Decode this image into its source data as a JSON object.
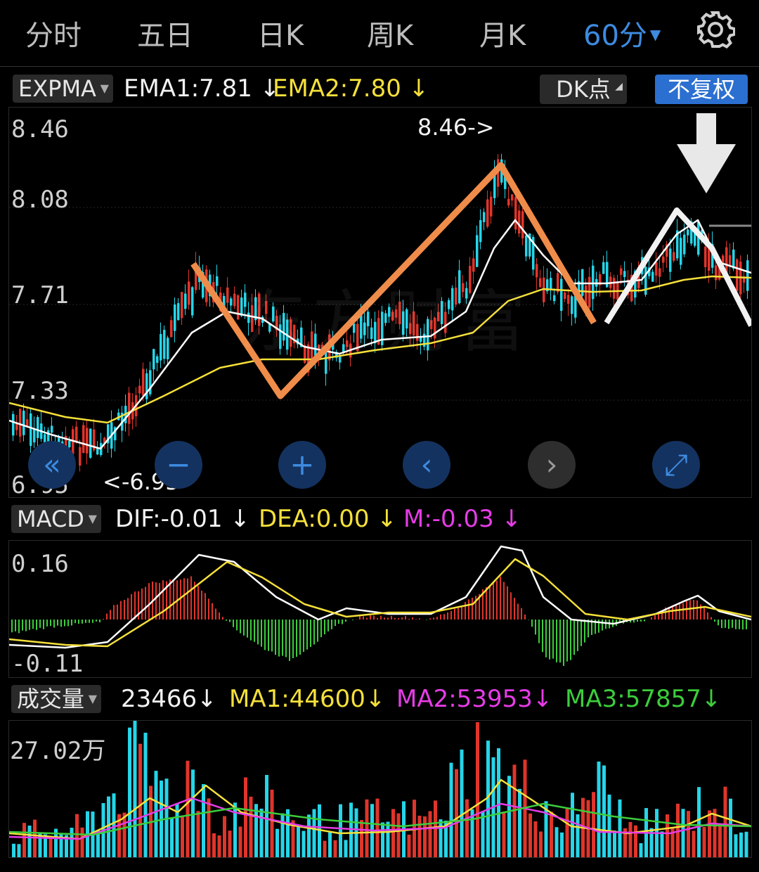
{
  "tabs": [
    {
      "label": "分时"
    },
    {
      "label": "五日"
    },
    {
      "label": "日K"
    },
    {
      "label": "周K"
    },
    {
      "label": "月K"
    },
    {
      "label": "60分",
      "active": true
    }
  ],
  "settings_icon": "gear-icon",
  "main_indicator": {
    "selector": "EXPMA",
    "ema1": "EMA1:7.81",
    "ema2": "EMA2:7.80",
    "arrow": "↓",
    "dk_button": "DK点",
    "adjust_button": "不复权",
    "y_ticks": [
      "8.46",
      "8.08",
      "7.71",
      "7.33",
      "6.95"
    ],
    "high_label": "8.46->",
    "low_label": "<-6.95",
    "watermark": "东方财富"
  },
  "nav_buttons": [
    {
      "name": "rewind-icon",
      "glyph": "«"
    },
    {
      "name": "zoom-out-icon",
      "glyph": "−"
    },
    {
      "name": "zoom-in-icon",
      "glyph": "+"
    },
    {
      "name": "prev-icon",
      "glyph": "‹"
    },
    {
      "name": "next-icon",
      "glyph": "›"
    },
    {
      "name": "fullscreen-icon",
      "glyph": "⤢"
    }
  ],
  "macd": {
    "selector": "MACD",
    "dif": "DIF:-0.01",
    "dea": "DEA:0.00",
    "m": "M:-0.03",
    "arrow": "↓",
    "y_ticks": [
      "0.16",
      "-0.11"
    ]
  },
  "volume": {
    "selector": "成交量",
    "value": "23466",
    "ma1": "MA1:44600",
    "ma2": "MA2:53953",
    "ma3": "MA3:57857",
    "arrow": "↓",
    "y_max": "27.02万"
  },
  "colors": {
    "up": "#e0352b",
    "down": "#25d5e8",
    "ema1": "#ffffff",
    "ema2": "#f5e03a",
    "annotation_orange": "#f08c4a",
    "annotation_white": "#f2f2f2",
    "accent": "#3d8be0"
  },
  "chart_data": {
    "type": "candlestick",
    "title": "",
    "ylim": [
      6.95,
      8.46
    ],
    "high": 8.46,
    "low": 6.95,
    "ema1_last": 7.81,
    "ema2_last": 7.8,
    "macd": {
      "dif": -0.01,
      "dea": 0.0,
      "m": -0.03,
      "ylim": [
        -0.11,
        0.16
      ]
    },
    "volume": {
      "last": 23466,
      "ma1": 44600,
      "ma2": 53953,
      "ma3": 57857,
      "max": 270200
    }
  }
}
